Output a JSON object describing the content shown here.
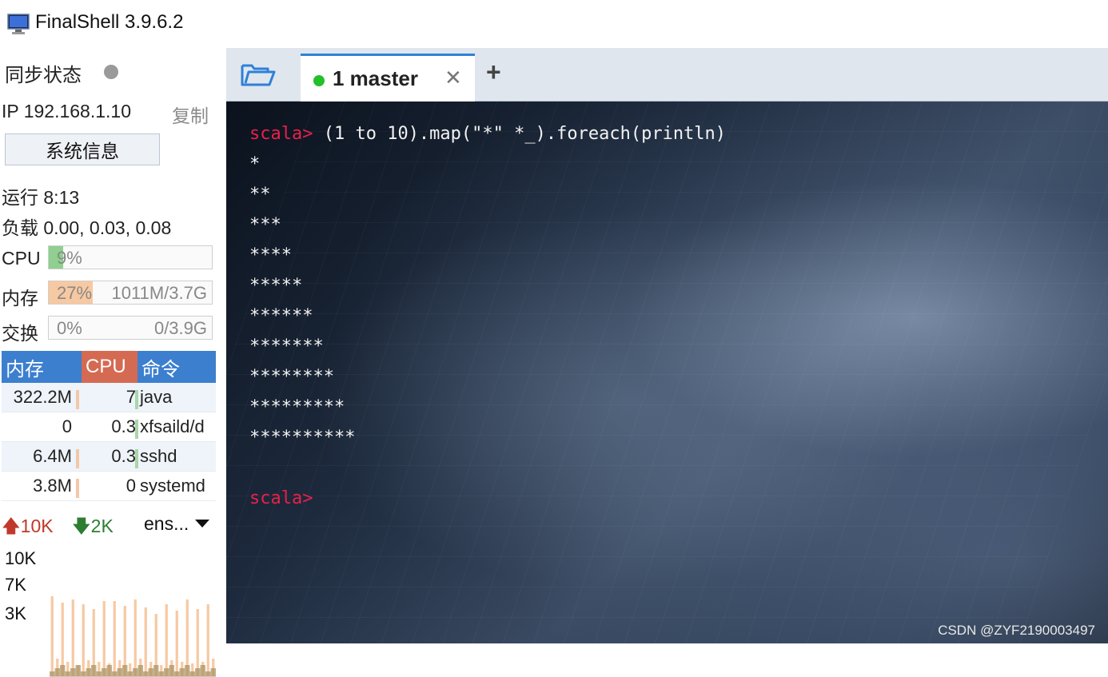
{
  "window": {
    "title": "FinalShell 3.9.6.2",
    "icon": "monitor-icon"
  },
  "sidebar": {
    "sync_label": "同步状态",
    "sync_status_color": "#9a9a9a",
    "ip_text": "IP 192.168.1.10",
    "copy_label": "复制",
    "sysinfo_button": "系统信息",
    "uptime": "运行 8:13",
    "load": "负载 0.00, 0.03, 0.08",
    "cpu": {
      "label": "CPU",
      "percent_text": "9%",
      "fraction": 0.09,
      "color": "#8fcf8f"
    },
    "memory": {
      "label": "内存",
      "percent_text": "27%",
      "amount": "1011M/3.7G",
      "fraction": 0.27,
      "color": "#f7c9a2"
    },
    "swap": {
      "label": "交换",
      "percent_text": "0%",
      "amount": "0/3.9G",
      "fraction": 0,
      "color": "#f7c9a2"
    },
    "process_table": {
      "headers": {
        "mem": "内存",
        "cpu": "CPU",
        "cmd": "命令"
      },
      "rows": [
        {
          "mem": "322.2M",
          "cpu": "7",
          "cmd": "java"
        },
        {
          "mem": "0",
          "cpu": "0.3",
          "cmd": "xfsaild/d"
        },
        {
          "mem": "6.4M",
          "cpu": "0.3",
          "cmd": "sshd"
        },
        {
          "mem": "3.8M",
          "cpu": "0",
          "cmd": "systemd"
        }
      ]
    },
    "network": {
      "up": "10K",
      "down": "2K",
      "interface": "ens...",
      "y_ticks": [
        "10K",
        "7K",
        "3K"
      ],
      "bar_color": "#f7c9a2",
      "bar_color_low": "#a89060"
    }
  },
  "tabs": {
    "folder_icon": "folder-icon",
    "items": [
      {
        "label": "1 master",
        "status_color": "#22c02a",
        "close": "✕"
      }
    ],
    "add_label": "+"
  },
  "terminal": {
    "prompt": "scala>",
    "command": " (1 to 10).map(\"*\" *_).foreach(println)",
    "output": [
      "*",
      "**",
      "***",
      "****",
      "*****",
      "******",
      "*******",
      "********",
      "*********",
      "**********"
    ],
    "final_prompt": "scala>",
    "watermark": "CSDN @ZYF2190003497"
  }
}
